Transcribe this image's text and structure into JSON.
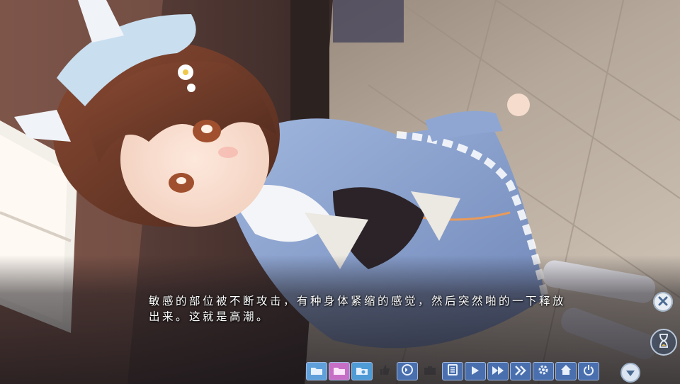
{
  "dialogue": {
    "text": "敏感的部位被不断攻击，有种身体紧缩的感觉，然后突然啪的一下释放\n出来。这就是高潮。"
  },
  "controls": {
    "close_icon": "close-icon",
    "wait_icon": "hourglass-icon",
    "toolbar": [
      {
        "name": "quick-save-button",
        "icon": "folder-save-icon"
      },
      {
        "name": "quick-load-button",
        "icon": "folder-load-icon"
      },
      {
        "name": "save-button",
        "icon": "folder-icon"
      },
      {
        "name": "favorite-button",
        "icon": "thumb-icon"
      },
      {
        "name": "voice-replay-button",
        "icon": "voice-icon"
      },
      {
        "name": "screenshot-button",
        "icon": "camera-icon"
      },
      {
        "name": "log-button",
        "icon": "log-icon"
      },
      {
        "name": "auto-button",
        "icon": "play-icon"
      },
      {
        "name": "skip-button",
        "icon": "fast-forward-icon"
      },
      {
        "name": "skip-all-button",
        "icon": "double-chevron-icon"
      },
      {
        "name": "config-button",
        "icon": "gear-icon"
      },
      {
        "name": "title-button",
        "icon": "home-icon"
      },
      {
        "name": "exit-button",
        "icon": "power-icon"
      }
    ],
    "scroll_icon": "chevron-down-icon"
  },
  "colors": {
    "text": "#ffffff",
    "button_blue": "#4a6fae",
    "button_border": "#9fb8e0"
  }
}
